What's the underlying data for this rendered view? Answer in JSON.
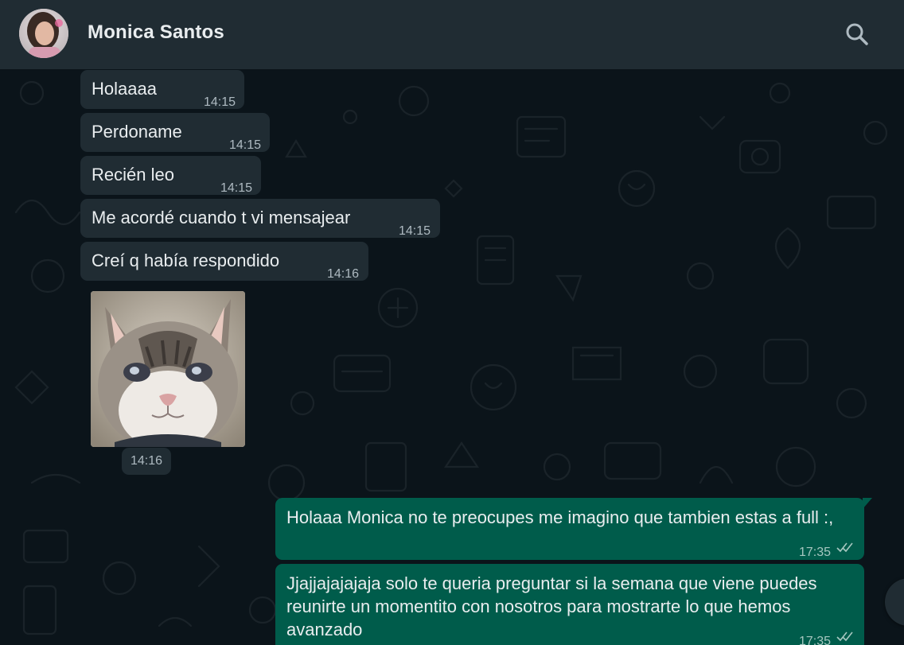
{
  "header": {
    "contact_name": "Monica Santos",
    "avatar_icon": "contact-avatar",
    "search_icon": "search-icon"
  },
  "messages_in": [
    {
      "text": "Holaaaa",
      "time": "14:15"
    },
    {
      "text": "Perdoname",
      "time": "14:15"
    },
    {
      "text": "Recién leo",
      "time": "14:15"
    },
    {
      "text": "Me acordé cuando t vi mensajear",
      "time": "14:15"
    },
    {
      "text": "Creí q había respondido",
      "time": "14:16"
    }
  ],
  "image_message": {
    "time": "14:16",
    "content": "cat-photo"
  },
  "messages_out": [
    {
      "lines": [
        "Holaaa Monica no te preocupes me imagino que tambien estas a full :,"
      ],
      "time": "17:35",
      "status": "read-double-check"
    },
    {
      "lines": [
        "Jjajjajajajaja solo te queria preguntar si la semana que viene puedes",
        "reunirte un momentito con nosotros para mostrarte lo que hemos",
        "avanzado"
      ],
      "time": "17:35",
      "status": "read-double-check"
    }
  ],
  "colors": {
    "header_bg": "#202c33",
    "chat_bg": "#0b141a",
    "incoming_bubble": "#202c33",
    "outgoing_bubble": "#005c4b"
  }
}
